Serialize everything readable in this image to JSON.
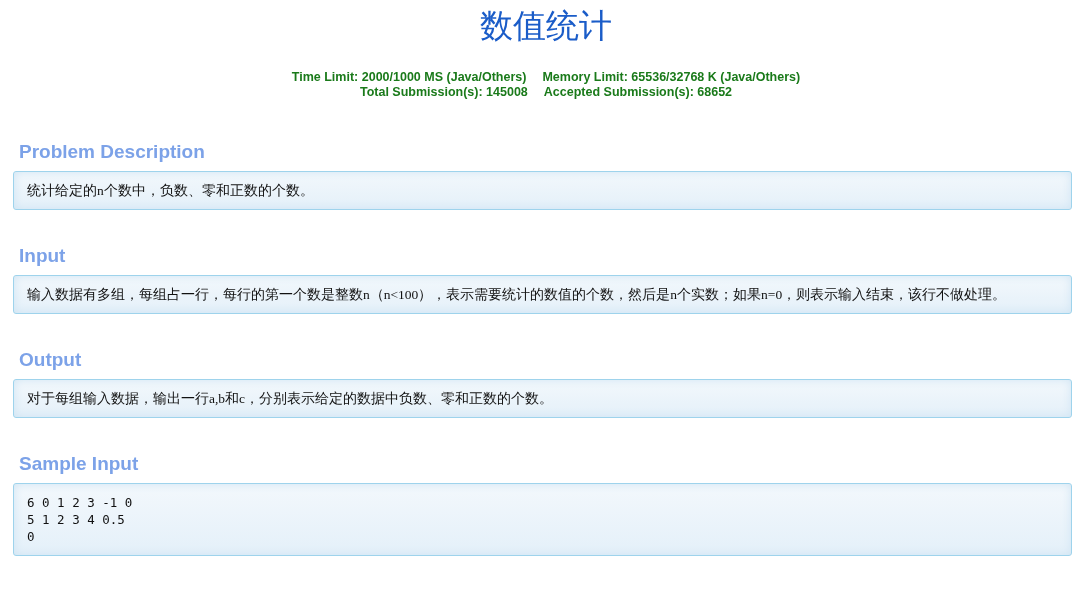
{
  "title": "数值统计",
  "limits": [
    "Time Limit: 2000/1000 MS (Java/Others)",
    "Memory Limit: 65536/32768 K (Java/Others)"
  ],
  "submissions": [
    "Total Submission(s): 145008",
    "Accepted Submission(s): 68652"
  ],
  "sections": [
    {
      "heading": "Problem Description",
      "kind": "text",
      "lines": [
        "统计给定的n个数中，负数、零和正数的个数。"
      ]
    },
    {
      "heading": "Input",
      "kind": "text",
      "lines": [
        "输入数据有多组，每组占一行，每行的第一个数是整数n（n<100），表示需要统计的数值的个数，然后是n个实数；如果n=0，则表示输入结束，该行不做处理。"
      ]
    },
    {
      "heading": "Output",
      "kind": "text",
      "lines": [
        "对于每组输入数据，输出一行a,b和c，分别表示给定的数据中负数、零和正数的个数。"
      ]
    },
    {
      "heading": "Sample Input",
      "kind": "code",
      "lines": [
        "6 0 1 2 3 -1 0",
        "5 1 2 3 4 0.5",
        "0"
      ]
    }
  ]
}
